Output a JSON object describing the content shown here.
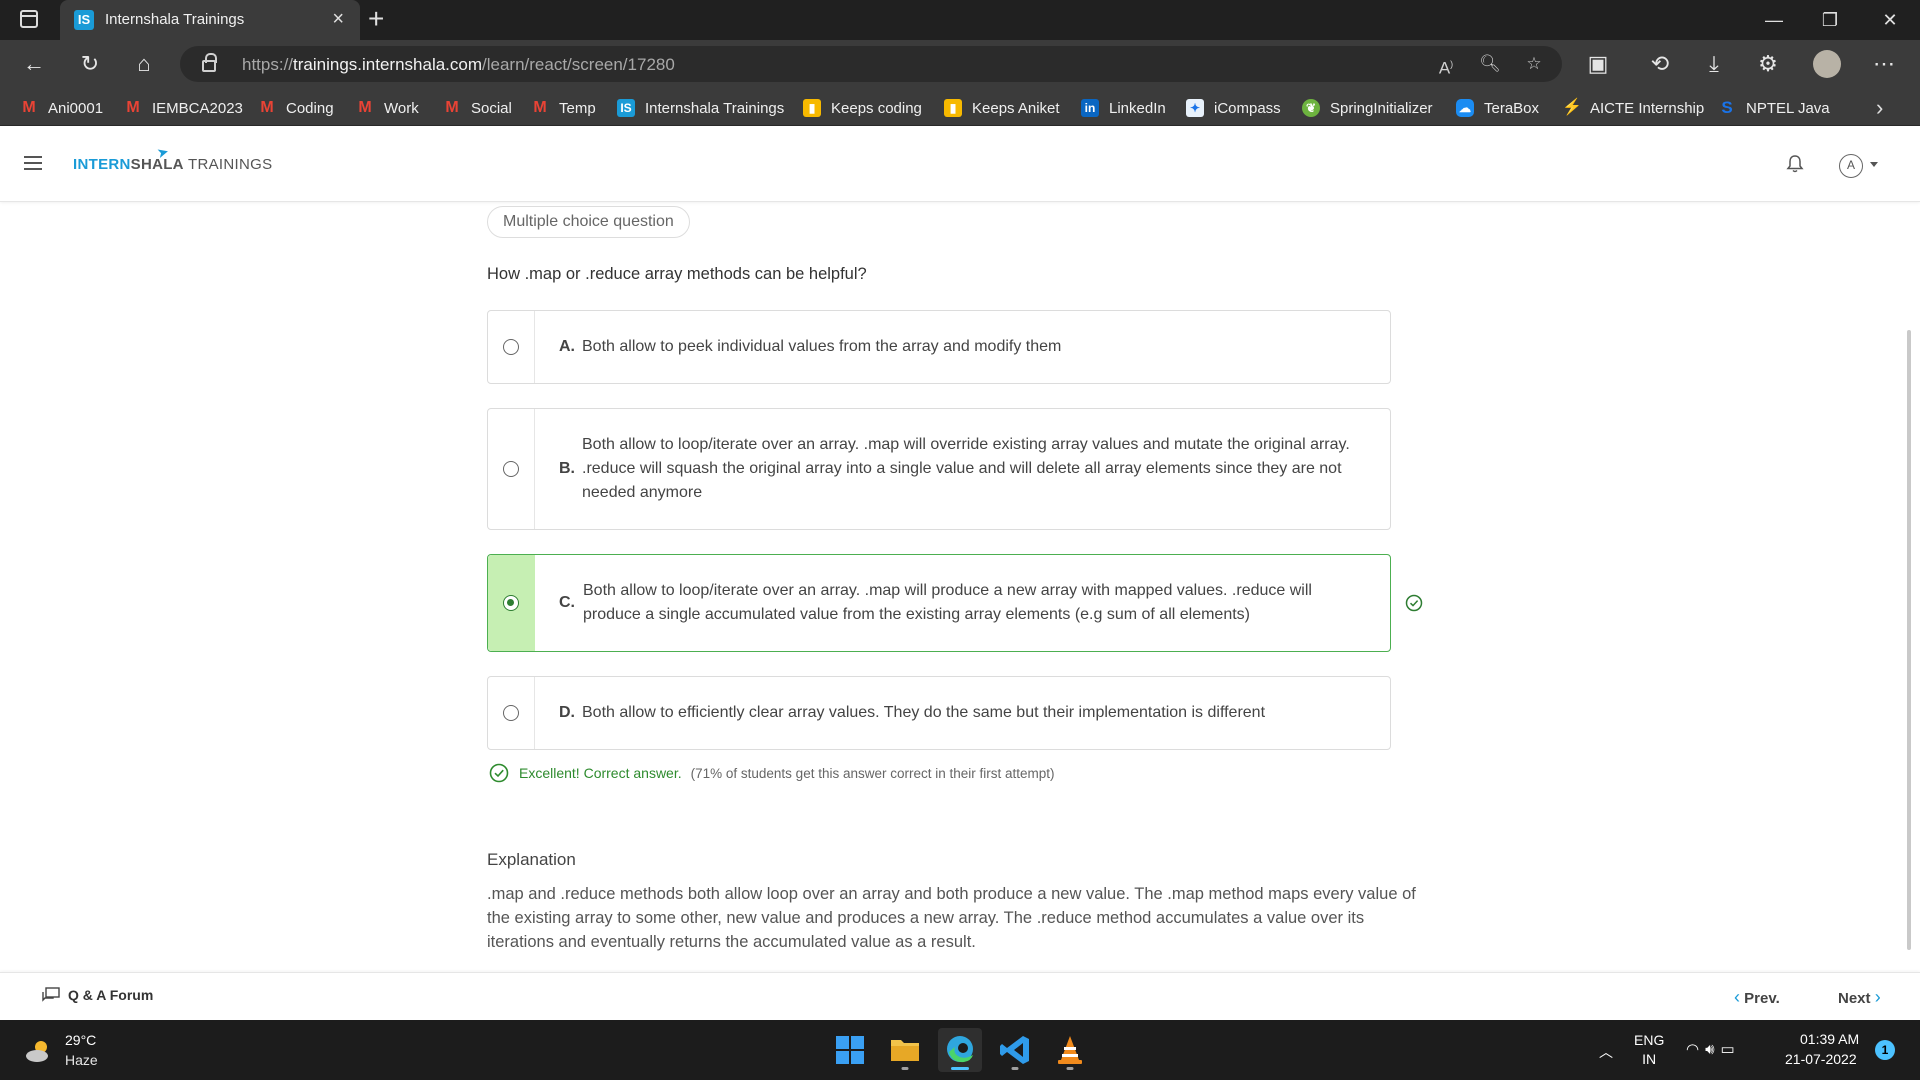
{
  "browser": {
    "tab_title": "Internshala Trainings",
    "tab_favicon": "IS",
    "tab_close": "×",
    "new_tab": "+",
    "url_prefix": "https://",
    "url_host": "trainings.internshala.com",
    "url_path": "/learn/react/screen/17280",
    "read_aloud": "A̅̀",
    "bookmarks": [
      {
        "label": "Ani0001",
        "icon": "gmail"
      },
      {
        "label": "IEMBCA2023",
        "icon": "gmail"
      },
      {
        "label": "Coding",
        "icon": "gmail"
      },
      {
        "label": "Work",
        "icon": "gmail"
      },
      {
        "label": "Social",
        "icon": "gmail"
      },
      {
        "label": "Temp",
        "icon": "gmail"
      },
      {
        "label": "Internshala Trainings",
        "icon": "internshala"
      },
      {
        "label": "Keeps coding",
        "icon": "google-keep"
      },
      {
        "label": "Keeps Aniket",
        "icon": "google-keep"
      },
      {
        "label": "LinkedIn",
        "icon": "linkedin"
      },
      {
        "label": "iCompass",
        "icon": "icompass"
      },
      {
        "label": "SpringInitializer",
        "icon": "spring"
      },
      {
        "label": "TeraBox",
        "icon": "terabox"
      },
      {
        "label": "AICTE Internship",
        "icon": "aicte"
      },
      {
        "label": "NPTEL Java",
        "icon": "nptel"
      }
    ]
  },
  "header": {
    "logo_part1": "INTERN",
    "logo_part2": "SHALA",
    "logo_part3": " TRAININGS",
    "account_initial": "A"
  },
  "question": {
    "type_label": "Multiple choice question",
    "text": "How .map or .reduce array methods can be helpful?",
    "options": [
      {
        "letter": "A.",
        "text": "Both allow to peek individual values from the array and modify them",
        "selected": false,
        "correct": false
      },
      {
        "letter": "B.",
        "text": "Both allow to loop/iterate over an array. .map will override existing array values and mutate the original array. .reduce will squash the original array into a single value and will delete all array elements since they are not needed anymore",
        "selected": false,
        "correct": false
      },
      {
        "letter": "C.",
        "text": "Both allow to loop/iterate over an array. .map will produce a new array with mapped values. .reduce will produce a single accumulated value from the existing array elements (e.g sum of all elements)",
        "selected": true,
        "correct": true
      },
      {
        "letter": "D.",
        "text": "Both allow to efficiently clear array values. They do the same but their implementation is different",
        "selected": false,
        "correct": false
      }
    ],
    "feedback_main": "Excellent! Correct answer.",
    "feedback_stat": "(71% of students get this answer correct in their first attempt)"
  },
  "explanation": {
    "title": "Explanation",
    "body": ".map and .reduce methods both allow loop over an array and both produce a new value. The .map method maps every value of the existing array to some other, new value and produces a new array. The .reduce method accumulates a value over its iterations and eventually returns the accumulated value as a result."
  },
  "footer": {
    "forum_label": "Q & A Forum",
    "prev_label": "Prev.",
    "next_label": "Next"
  },
  "taskbar": {
    "temperature": "29°C",
    "weather": "Haze",
    "lang_line1": "ENG",
    "lang_line2": "IN",
    "time": "01:39 AM",
    "date": "21-07-2022",
    "notifications": "1"
  },
  "colors": {
    "brand": "#1a9bd7",
    "correct_green": "#4caf50",
    "correct_fill": "#c6efb3",
    "taskbar": "#1c1c1c",
    "browser_chrome": "#3b3b3b"
  }
}
